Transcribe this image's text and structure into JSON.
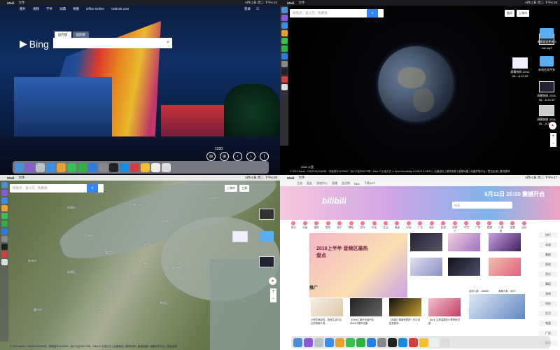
{
  "q1": {
    "menubar": {
      "app": "iWall",
      "menu": "文件",
      "clock": "6月12日 周二 下午6:24"
    },
    "nav": [
      "图片",
      "视频",
      "学术",
      "词典",
      "地图",
      "Office Online",
      "Outlook.com"
    ],
    "topright": [
      "登录"
    ],
    "logo": "Bing",
    "tabs": [
      "国内版",
      "国际版"
    ],
    "count": "1330",
    "controls": [
      "⊞",
      "⊞",
      "‹",
      "›",
      "i"
    ]
  },
  "q2": {
    "menubar": {
      "app": "iWall",
      "menu": "文件",
      "clock": "6月12日 周二 下午6:28"
    },
    "search_placeholder": "搜地点、查公交、找路线",
    "toolbar": [
      "路况",
      "上海市"
    ],
    "desktop": [
      {
        "label": "屏幕快照\n2018-06-...6.22.49",
        "kind": "thumb"
      },
      {
        "label": "mtv.mp4",
        "kind": "thumb"
      },
      {
        "label": "未命名文件夹",
        "kind": "folder"
      },
      {
        "label": "未命名文件夹 2",
        "kind": "folder"
      },
      {
        "label": "屏幕快照\n2018-06-...6.24.39",
        "kind": "thumb"
      },
      {
        "label": "屏幕快照\n2018-06-...6.27.30",
        "kind": "thumb"
      }
    ],
    "scale": "2000 公里",
    "footer": "© 2018 Baidu - GS(2016)2089号 - 甲测资字1100930 - 京ICP证030173号 - Data © 长地万方 & OpenStreetMap & INEGI & ANSC | 百度首页 | 服务条款 | 高德地图 | 地图开放平台 | 意见反馈 | 路况推荐"
  },
  "q3": {
    "menubar": {
      "app": "iWall",
      "menu": "文件",
      "clock": "6月12日 周二 下午6:29"
    },
    "search_placeholder": "搜地点、查公交、找路线",
    "toolbar": [
      "上海市",
      "工具"
    ],
    "places": [
      {
        "name": "南通市"
      },
      {
        "name": "启东市"
      },
      {
        "name": "苏州市"
      },
      {
        "name": "太仓市"
      },
      {
        "name": "嘉定区"
      },
      {
        "name": "宝山区"
      },
      {
        "name": "上海市"
      },
      {
        "name": "浦东新区"
      },
      {
        "name": "青浦区"
      },
      {
        "name": "松江区"
      },
      {
        "name": "闵行区"
      },
      {
        "name": "奉贤区"
      },
      {
        "name": "金山区"
      },
      {
        "name": "嘉兴市"
      },
      {
        "name": "崇明区"
      },
      {
        "name": "海门市"
      }
    ],
    "footer": "© 2018 Baidu - GS(2016)2089号 - 甲测资字1100930 - 京ICP证030173号 - Data © 长地万方 | 百度首页 | 服务条款 | 高德地图 | 地图开放平台 | 意见反馈"
  },
  "q4": {
    "menubar": {
      "app": "iWall",
      "menu": "文件",
      "clock": "6月12日 周二 下午6:47"
    },
    "top_links": [
      "主站",
      "画友",
      "游戏中心",
      "直播",
      "会员购",
      "BML",
      "下载APP"
    ],
    "logo": "bilibili",
    "search_placeholder": "搜索",
    "slogan": "6月11日 20:00 震撼开启",
    "nav": [
      "首页",
      "动画",
      "番剧",
      "国创",
      "音乐",
      "舞蹈",
      "游戏",
      "科技",
      "生活",
      "鬼畜",
      "时尚",
      "广告",
      "娱乐",
      "影视",
      "放映厅",
      "专栏",
      "广场",
      "直播",
      "小黑屋",
      "话题",
      "活动"
    ],
    "hero_title": "2018上半年 音频区最热盘点",
    "promo_label": "推广",
    "right_col": [
      "排行",
      "动画",
      "番剧",
      "国创",
      "音乐",
      "舞蹈",
      "游戏",
      "科技",
      "生活",
      "鬼畜",
      "广告",
      "娱乐"
    ],
    "promo_items": [
      "小职员满足啦，把我生活中见过的奇葩人类…",
      "【Gtrix】最行业级气化 WAVES原声合集",
      "【科普】搬播世界杯！可以说是真的和…",
      "【sic】文静温柔的小哥哥你们想…",
      "游戏人数：186660",
      "观看人数：5670"
    ]
  }
}
